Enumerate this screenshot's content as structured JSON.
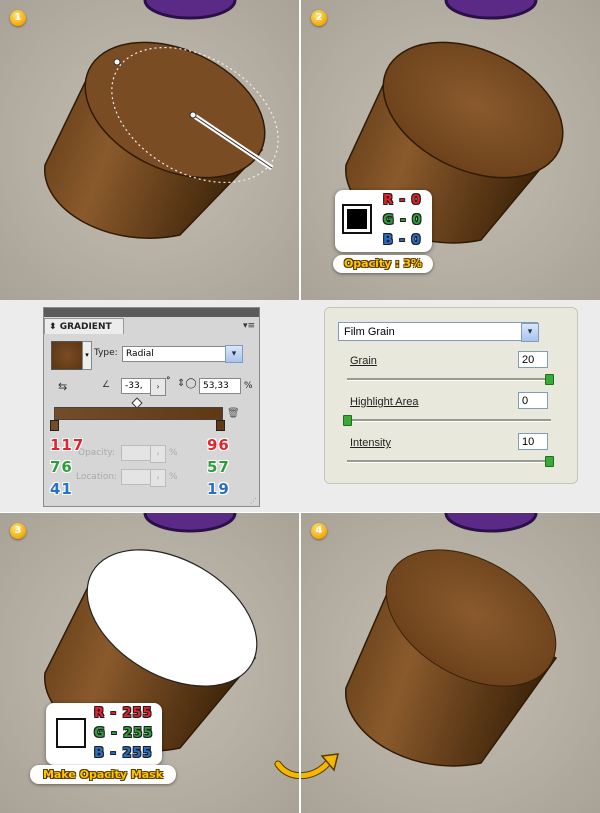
{
  "steps": [
    {
      "badge": "1"
    },
    {
      "badge": "2"
    },
    {
      "badge": "3"
    },
    {
      "badge": "4"
    }
  ],
  "step2_color_box": {
    "r_label": "R - 0",
    "g_label": "G - 0",
    "b_label": "B - 0",
    "swatch_color": "#000000",
    "opacity_label": "Opacity : 3%"
  },
  "step3_color_box": {
    "r_label": "R - 255",
    "g_label": "G - 255",
    "b_label": "B - 255",
    "swatch_color": "#ffffff",
    "action_label": "Make Opacity Mask"
  },
  "gradient_panel": {
    "tab_title": "GRADIENT",
    "type_label": "Type:",
    "type_value": "Radial",
    "angle_value": "-33,",
    "aspect_value": "53,33",
    "aspect_unit": "%",
    "opacity_label": "Opacity:",
    "location_label": "Location:",
    "percent": "%",
    "left_stop": {
      "r": "117",
      "g": "76",
      "b": "41"
    },
    "right_stop": {
      "r": "96",
      "g": "57",
      "b": "19"
    }
  },
  "film_grain": {
    "filter_name": "Film Grain",
    "grain_label": "Grain",
    "grain_value": "20",
    "grain_level": 0.99,
    "highlight_label": "Highlight Area",
    "highlight_value": "0",
    "highlight_level": 0.0,
    "intensity_label": "Intensity",
    "intensity_value": "10",
    "intensity_level": 0.99
  },
  "colors": {
    "red": "#e8222b",
    "green": "#2e9e3b",
    "blue": "#2a6fc9",
    "brown_light": "#754c29",
    "brown_dark": "#603913",
    "stone": "#b9b3a7",
    "arrow": "#f5b800",
    "purple": "#5b2a86"
  }
}
